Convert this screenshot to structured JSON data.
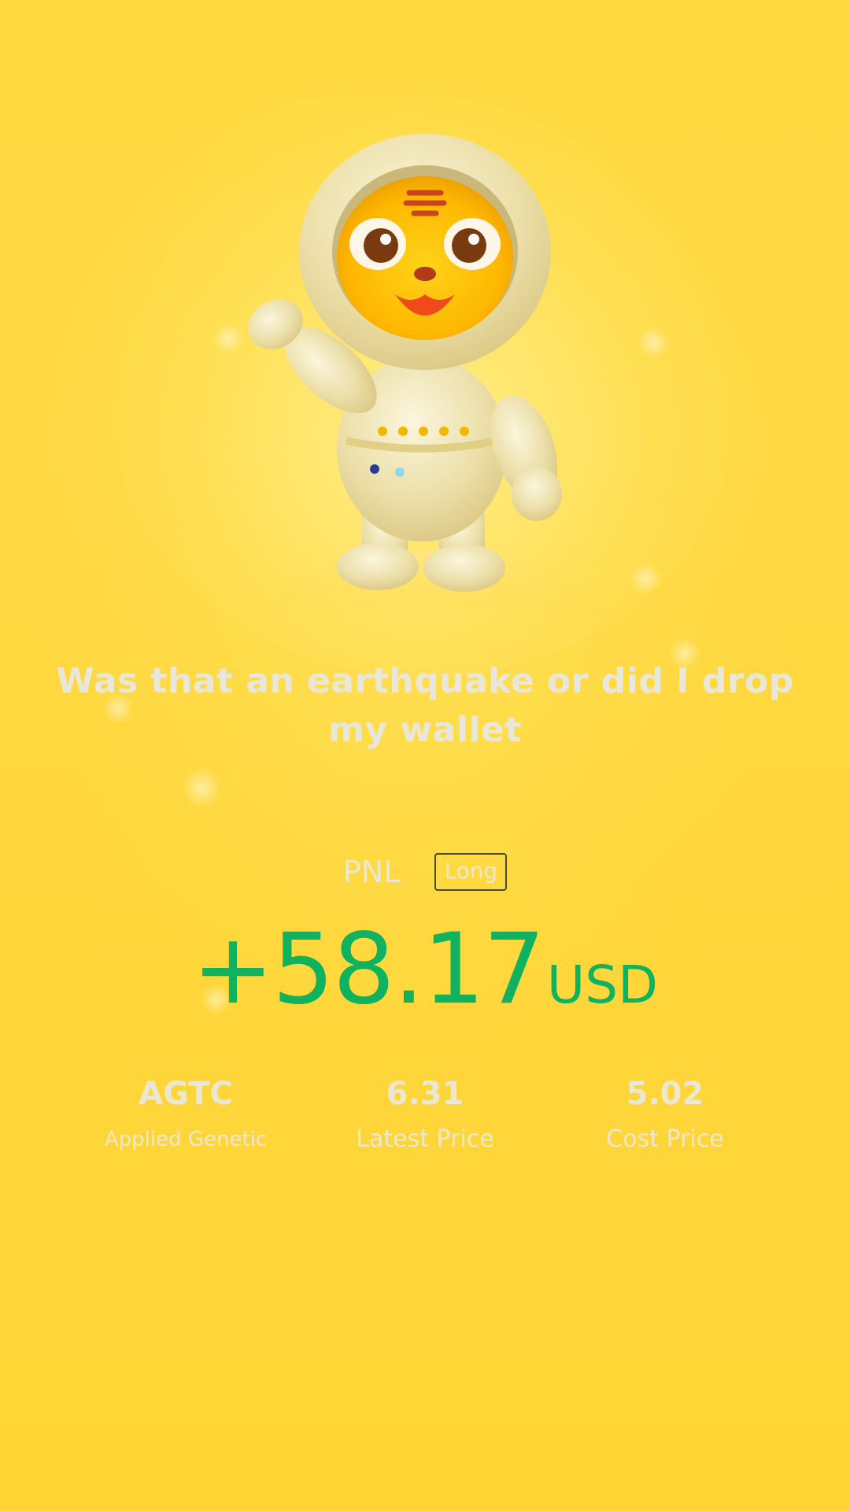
{
  "headline": "Was that an earthquake or did I drop my wallet",
  "pnl": {
    "label": "PNL",
    "side_badge": "Long",
    "amount": "+58.17",
    "unit": "USD"
  },
  "stats": [
    {
      "value": "AGTC",
      "label": "Applied Genetic"
    },
    {
      "value": "6.31",
      "label": "Latest Price"
    },
    {
      "value": "5.02",
      "label": "Cost Price"
    }
  ],
  "colors": {
    "background": "#ffd93f",
    "profit": "#10b260",
    "text_light": "#ece7d2"
  },
  "illustration": "tiger-astronaut-mascot"
}
